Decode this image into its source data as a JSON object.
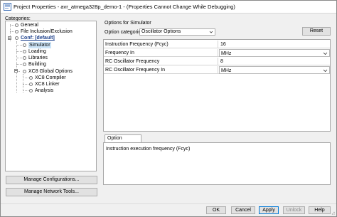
{
  "window": {
    "title": "Project Properties - avr_atmega328p_demo-1 - (Properties Cannot Change While Debugging)"
  },
  "categories": {
    "label": "Categories:",
    "items": [
      {
        "label": "General"
      },
      {
        "label": "File Inclusion/Exclusion"
      },
      {
        "label": "Conf: [default]"
      },
      {
        "label": "Simulator"
      },
      {
        "label": "Loading"
      },
      {
        "label": "Libraries"
      },
      {
        "label": "Building"
      },
      {
        "label": "XC8 Global Options"
      },
      {
        "label": "XC8 Compiler"
      },
      {
        "label": "XC8 Linker"
      },
      {
        "label": "Analysis"
      }
    ]
  },
  "left_buttons": {
    "manage_configurations": "Manage Configurations...",
    "manage_network_tools": "Manage Network Tools..."
  },
  "options": {
    "title": "Options for Simulator",
    "category_label": "Option categories:",
    "category_value": "Oscillator Options",
    "reset_label": "Reset",
    "rows": [
      {
        "name": "Instruction Frequency (Fcyc)",
        "value": "16"
      },
      {
        "name": "Frequency In",
        "value": "MHz"
      },
      {
        "name": "RC Oscillator Frequency",
        "value": "8"
      },
      {
        "name": "RC Oscillator Frequency In",
        "value": "MHz"
      }
    ],
    "description_tab": "Option Description",
    "description_text": "Instruction execution frequency (Fcyc)"
  },
  "footer": {
    "ok": "OK",
    "cancel": "Cancel",
    "apply": "Apply",
    "unlock": "Unlock",
    "help": "Help"
  },
  "colors": {
    "selection": "#cce4f7",
    "accent": "#0078d7"
  }
}
